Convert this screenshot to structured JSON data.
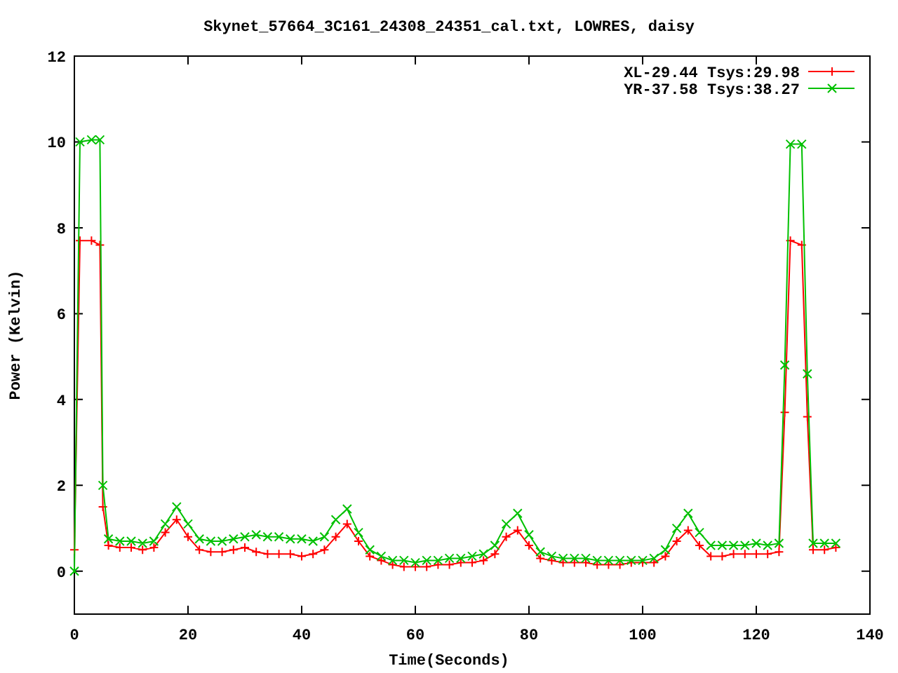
{
  "chart_data": {
    "type": "line",
    "title": "Skynet_57664_3C161_24308_24351_cal.txt, LOWRES, daisy",
    "xlabel": "Time(Seconds)",
    "ylabel": "Power (Kelvin)",
    "x": [
      0,
      1,
      3,
      4.5,
      5,
      6,
      8,
      10,
      12,
      14,
      16,
      18,
      20,
      22,
      24,
      26,
      28,
      30,
      32,
      34,
      36,
      38,
      40,
      42,
      44,
      46,
      48,
      50,
      52,
      54,
      56,
      58,
      60,
      62,
      64,
      66,
      68,
      70,
      72,
      74,
      76,
      78,
      80,
      82,
      84,
      86,
      88,
      90,
      92,
      94,
      96,
      98,
      100,
      102,
      104,
      106,
      108,
      110,
      112,
      114,
      116,
      118,
      120,
      122,
      124,
      125,
      126,
      128,
      129,
      130,
      132,
      134
    ],
    "series": [
      {
        "name": "XL-29.44 Tsys:29.98",
        "color": "#ff0000",
        "marker": "plus",
        "values": [
          0.5,
          7.7,
          7.7,
          7.6,
          1.5,
          0.6,
          0.55,
          0.55,
          0.5,
          0.55,
          0.9,
          1.2,
          0.8,
          0.5,
          0.45,
          0.45,
          0.5,
          0.55,
          0.45,
          0.4,
          0.4,
          0.4,
          0.35,
          0.4,
          0.5,
          0.8,
          1.1,
          0.7,
          0.35,
          0.25,
          0.15,
          0.1,
          0.1,
          0.1,
          0.15,
          0.15,
          0.2,
          0.2,
          0.25,
          0.4,
          0.8,
          0.95,
          0.6,
          0.3,
          0.25,
          0.2,
          0.2,
          0.2,
          0.15,
          0.15,
          0.15,
          0.2,
          0.2,
          0.2,
          0.35,
          0.7,
          0.95,
          0.6,
          0.35,
          0.35,
          0.4,
          0.4,
          0.4,
          0.4,
          0.45,
          3.7,
          7.7,
          7.6,
          3.6,
          0.5,
          0.5,
          0.55
        ]
      },
      {
        "name": "YR-37.58 Tsys:38.27",
        "color": "#00c000",
        "marker": "cross",
        "values": [
          0,
          10,
          10.05,
          10.05,
          2,
          0.75,
          0.7,
          0.7,
          0.65,
          0.7,
          1.1,
          1.5,
          1.1,
          0.75,
          0.7,
          0.7,
          0.75,
          0.8,
          0.85,
          0.8,
          0.8,
          0.75,
          0.75,
          0.7,
          0.8,
          1.2,
          1.45,
          0.9,
          0.5,
          0.35,
          0.25,
          0.25,
          0.2,
          0.25,
          0.25,
          0.3,
          0.3,
          0.35,
          0.4,
          0.6,
          1.1,
          1.35,
          0.85,
          0.45,
          0.35,
          0.3,
          0.3,
          0.3,
          0.25,
          0.25,
          0.25,
          0.25,
          0.25,
          0.3,
          0.5,
          1.0,
          1.35,
          0.9,
          0.6,
          0.6,
          0.6,
          0.6,
          0.65,
          0.6,
          0.65,
          4.8,
          9.95,
          9.95,
          4.6,
          0.65,
          0.65,
          0.65
        ]
      }
    ],
    "legend": "upper right",
    "xlim": [
      0,
      140
    ],
    "ylim": [
      -1,
      12
    ],
    "xticks": [
      0,
      20,
      40,
      60,
      80,
      100,
      120,
      140
    ],
    "yticks": [
      0,
      2,
      4,
      6,
      8,
      10,
      12
    ]
  }
}
